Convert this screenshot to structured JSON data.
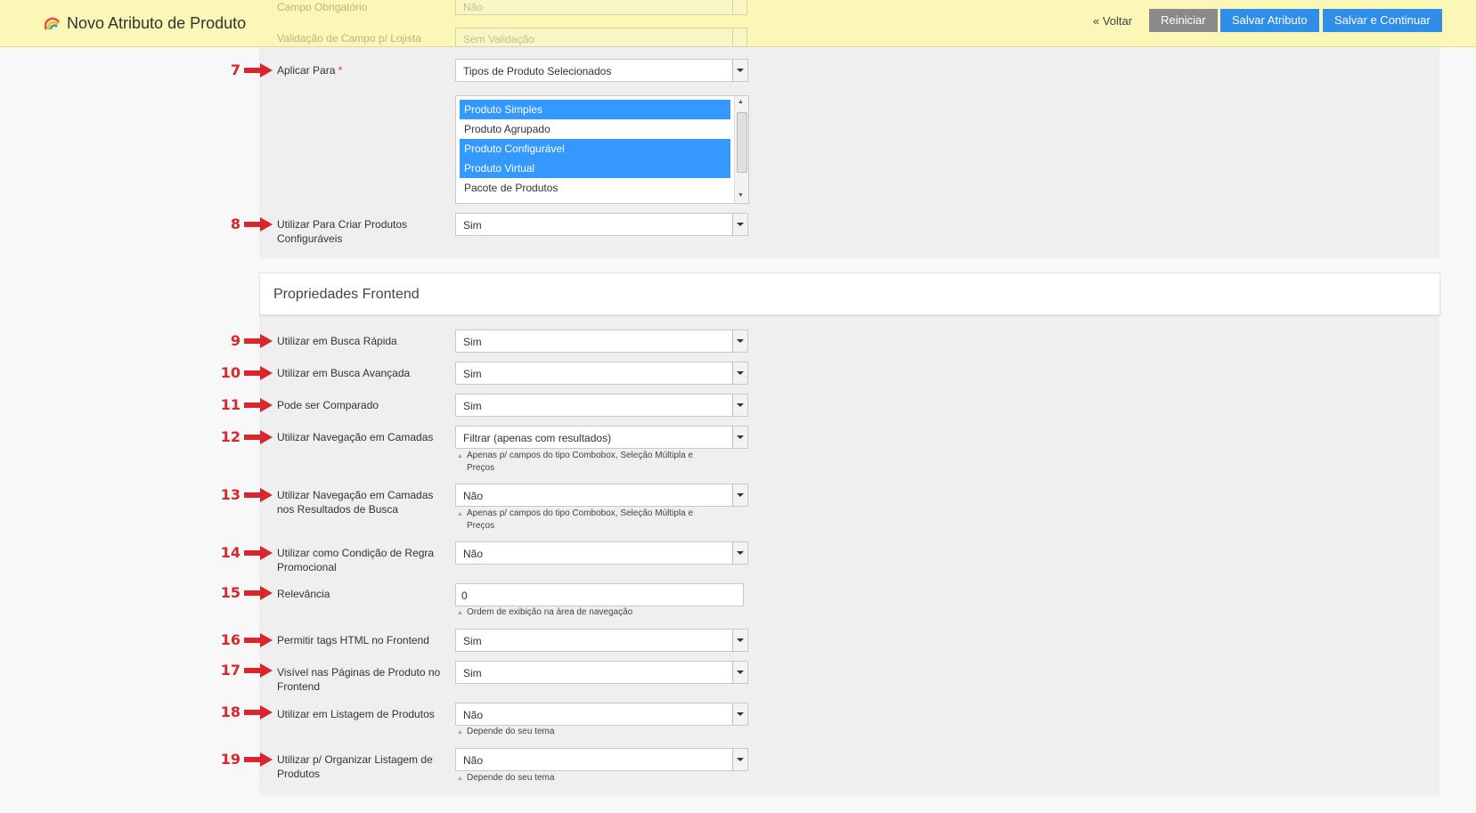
{
  "header": {
    "title": "Novo Atributo de Produto",
    "back_label": "« Voltar",
    "reset_label": "Reiniciar",
    "save_label": "Salvar Atributo",
    "save_continue_label": "Salvar e Continuar",
    "ghost_rows": [
      {
        "label": "Campo Obrigatório",
        "value": "Não"
      },
      {
        "label": "Validação de Campo p/ Lojista",
        "value": "Sem Validação"
      }
    ]
  },
  "apply_to": {
    "marker": "7",
    "label": "Aplicar Para",
    "required_mark": "*",
    "value": "Tipos de Produto Selecionados",
    "options": [
      {
        "label": "Produto Simples",
        "selected": true
      },
      {
        "label": "Produto Agrupado",
        "selected": false
      },
      {
        "label": "Produto Configurável",
        "selected": true
      },
      {
        "label": "Produto Virtual",
        "selected": true
      },
      {
        "label": "Pacote de Produtos",
        "selected": false
      }
    ]
  },
  "configurable": {
    "marker": "8",
    "label": "Utilizar Para Criar Produtos Configuráveis",
    "value": "Sim"
  },
  "frontend": {
    "title": "Propriedades Frontend",
    "fields": [
      {
        "marker": "9",
        "label": "Utilizar em Busca Rápida",
        "value": "Sim"
      },
      {
        "marker": "10",
        "label": "Utilizar em Busca Avançada",
        "value": "Sim"
      },
      {
        "marker": "11",
        "label": "Pode ser Comparado",
        "value": "Sim"
      },
      {
        "marker": "12",
        "label": "Utilizar Navegação em Camadas",
        "value": "Filtrar (apenas com resultados)",
        "note": "Apenas p/ campos do tipo Combobox, Seleção Múltipla e Preços"
      },
      {
        "marker": "13",
        "label": "Utilizar Navegação em Camadas nos Resultados de Busca",
        "value": "Não",
        "note": "Apenas p/ campos do tipo Combobox, Seleção Múltipla e Preços"
      },
      {
        "marker": "14",
        "label": "Utilizar como Condição de Regra Promocional",
        "value": "Não"
      },
      {
        "marker": "15",
        "label": "Relevância",
        "value": "0",
        "note": "Ordem de exibição na área de navegação"
      },
      {
        "marker": "16",
        "label": "Permitir tags HTML no Frontend",
        "value": "Sim"
      },
      {
        "marker": "17",
        "label": "Visível nas Páginas de Produto no Frontend",
        "value": "Sim"
      },
      {
        "marker": "18",
        "label": "Utilizar em Listagem de Produtos",
        "value": "Não",
        "note": "Depende do seu tema"
      },
      {
        "marker": "19",
        "label": "Utilizar p/ Organizar Listagem de Produtos",
        "value": "Não",
        "note": "Depende do seu tema"
      }
    ]
  },
  "colors": {
    "header_bg": "#fbf7b7",
    "primary_button": "#2f8ee8",
    "secondary_button": "#8a8a8a",
    "selected_option": "#3399ff",
    "marker": "#d9262c"
  }
}
